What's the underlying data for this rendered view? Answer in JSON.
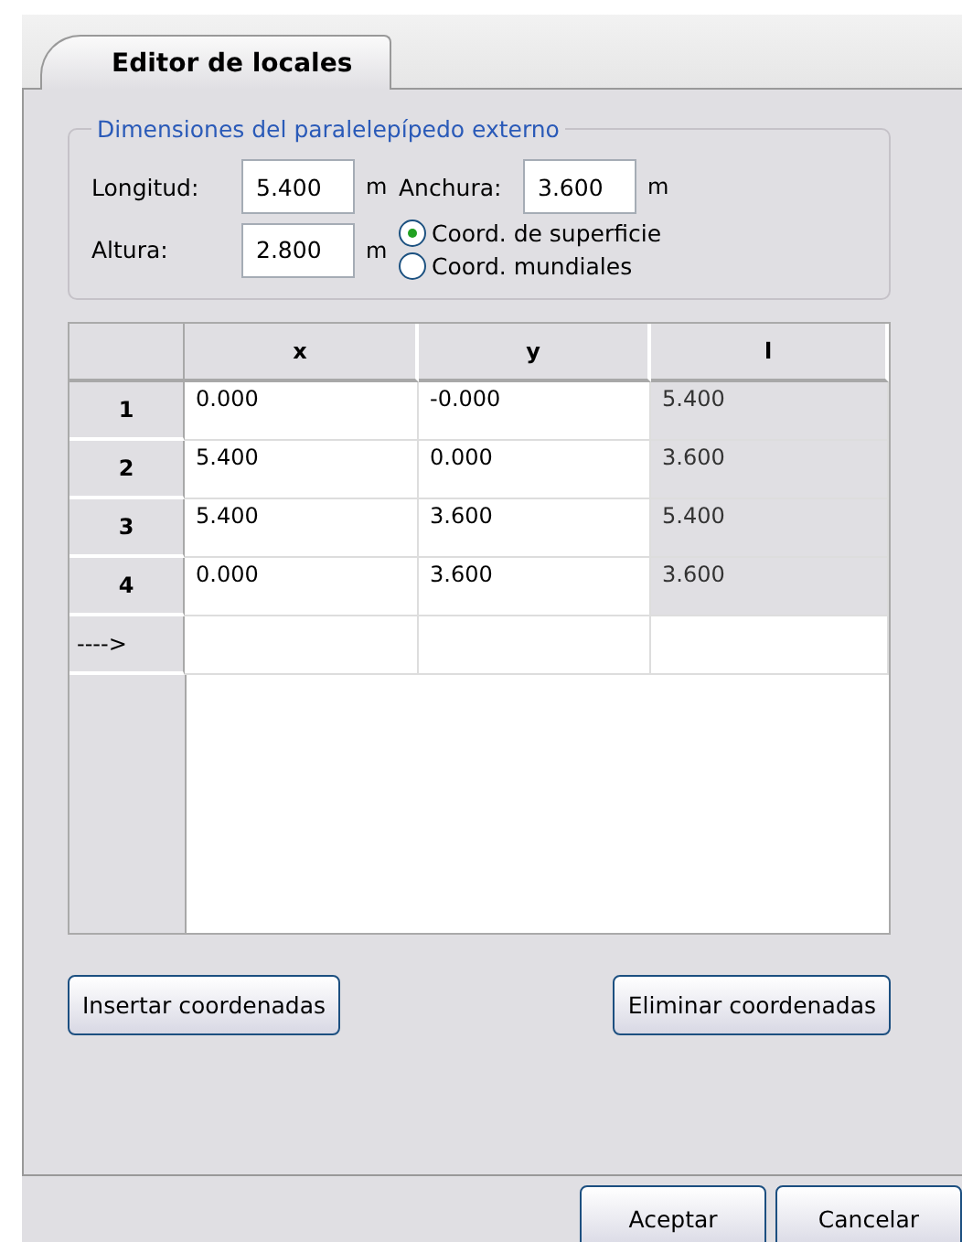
{
  "tabs": [
    {
      "label": "Editor de locales",
      "selected": true
    }
  ],
  "dimensions": {
    "title": "Dimensiones del paralelepípedo externo",
    "fields": [
      {
        "label": "Longitud:",
        "value": "5.400",
        "unit": "m"
      },
      {
        "label": "Anchura:",
        "value": "3.600",
        "unit": "m"
      },
      {
        "label": "Altura:",
        "value": "2.800",
        "unit": "m"
      }
    ],
    "radios": [
      {
        "label": "Coord. de superficie",
        "selected": true
      },
      {
        "label": "Coord. mundiales",
        "selected": false
      }
    ]
  },
  "table": {
    "columns": [
      {
        "label": "x",
        "readonly": false
      },
      {
        "label": "y",
        "readonly": false
      },
      {
        "label": "l",
        "readonly": true
      }
    ],
    "rows": [
      {
        "header": "1",
        "cells": [
          "0.000",
          "-0.000",
          "5.400"
        ]
      },
      {
        "header": "2",
        "cells": [
          "5.400",
          "0.000",
          "3.600"
        ]
      },
      {
        "header": "3",
        "cells": [
          "5.400",
          "3.600",
          "5.400"
        ]
      },
      {
        "header": "4",
        "cells": [
          "0.000",
          "3.600",
          "3.600"
        ]
      },
      {
        "header": "---->",
        "kind": "new"
      }
    ]
  },
  "actions": [
    "Insertar coordenadas",
    "Eliminar coordenadas"
  ],
  "buttons": [
    "Aceptar",
    "Cancelar"
  ]
}
